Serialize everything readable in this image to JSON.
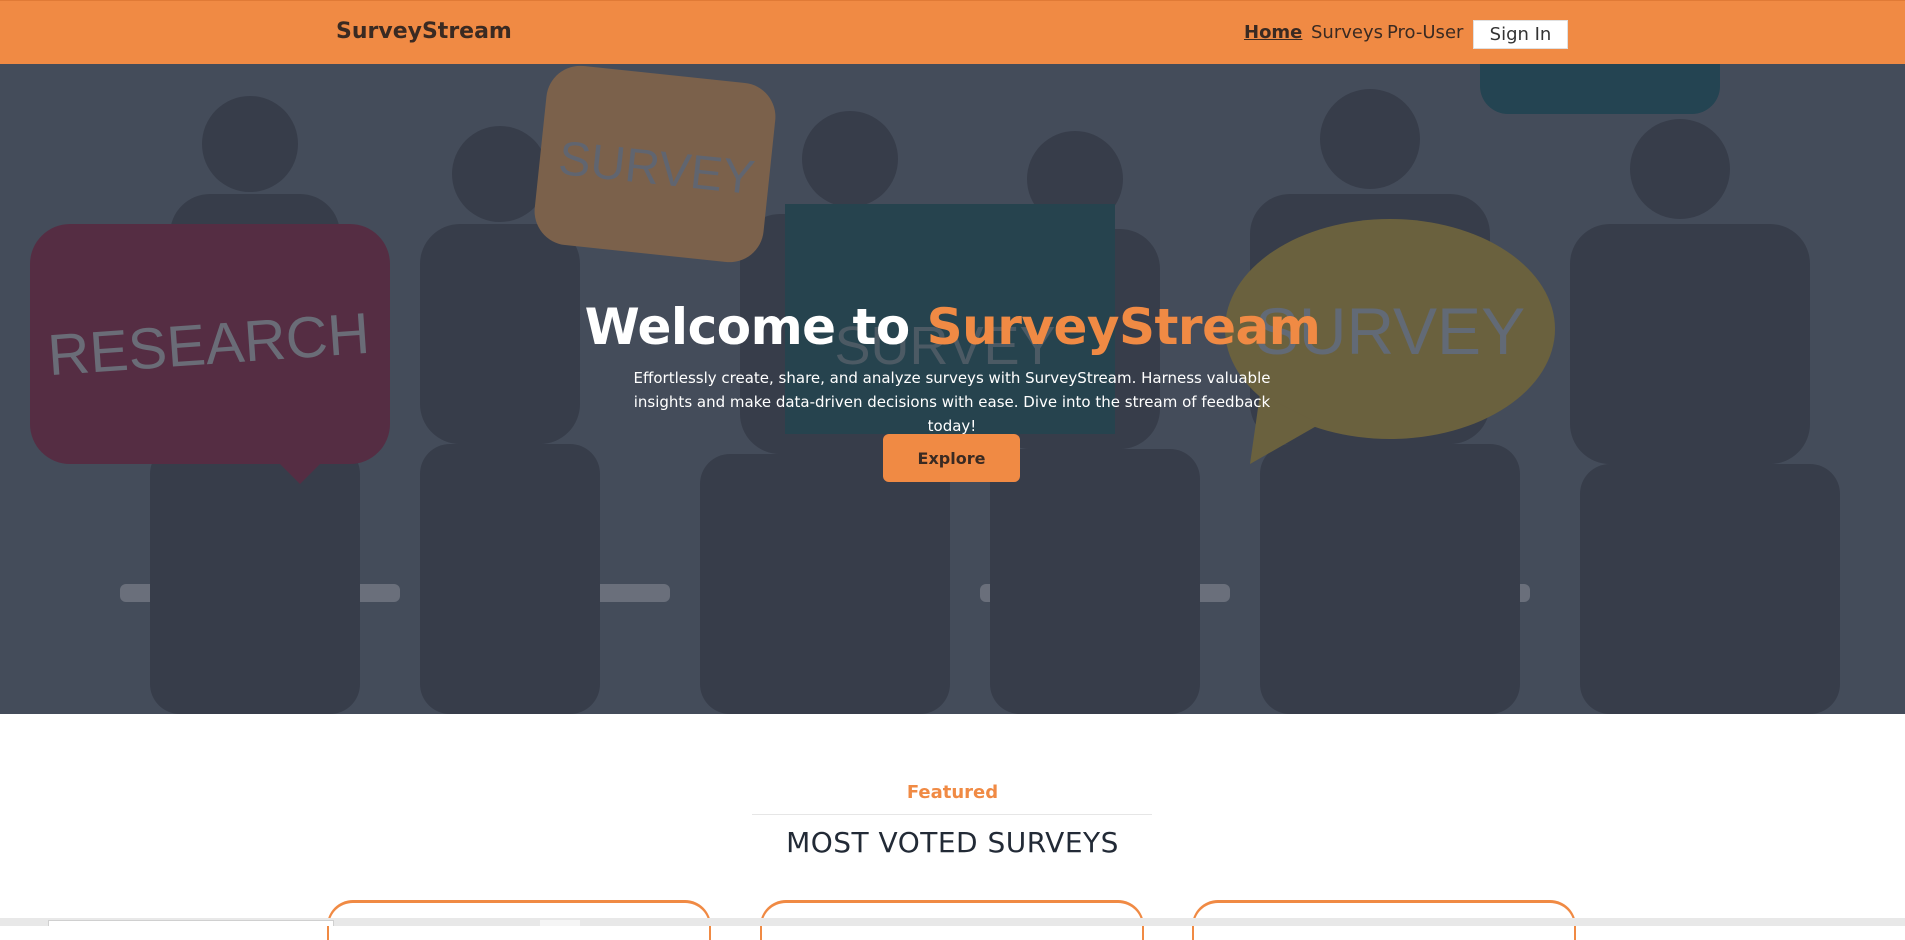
{
  "navbar": {
    "brand": "SurveyStream",
    "links": [
      "Home",
      "Surveys",
      "Pro-User"
    ],
    "signin_label": "Sign In"
  },
  "hero": {
    "title_prefix": "Welcome to ",
    "title_accent": "SurveyStream",
    "subtitle": "Effortlessly create, share, and analyze surveys with SurveyStream. Harness valuable insights and make data-driven decisions with ease. Dive into the stream of feedback today!",
    "explore_label": "Explore",
    "image_signs": [
      "RESEARCH",
      "SURVEY",
      "SURVEY",
      "SURVEY"
    ]
  },
  "featured": {
    "label": "Featured",
    "heading": "MOST VOTED SURVEYS"
  },
  "colors": {
    "accent": "#f08a44",
    "text_dark": "#222a36"
  }
}
